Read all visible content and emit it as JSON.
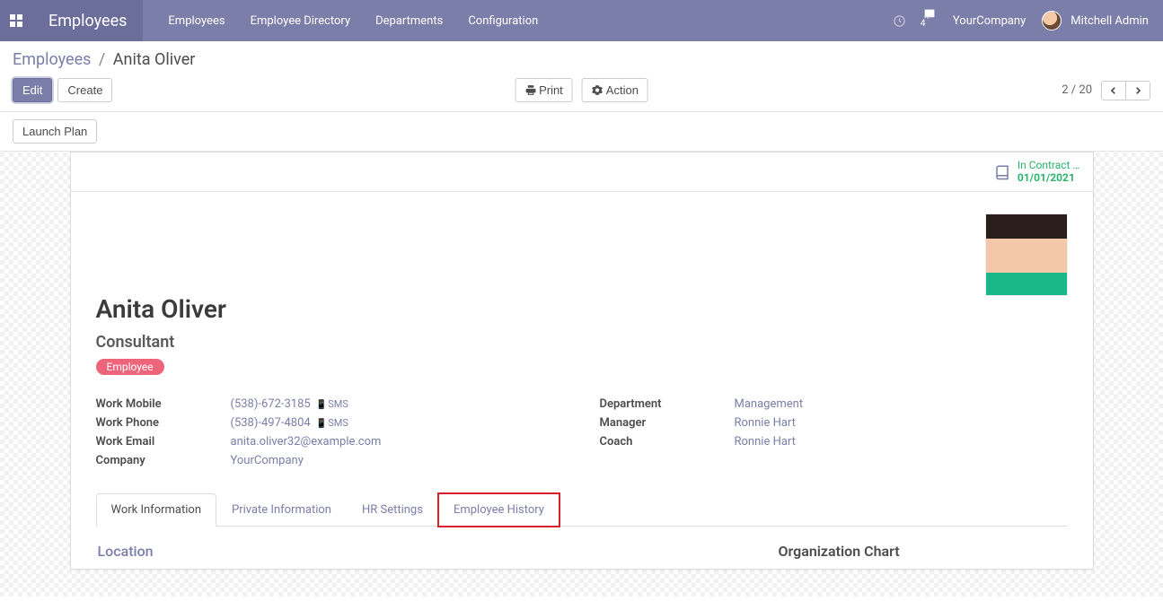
{
  "nav": {
    "app_name": "Employees",
    "links": [
      "Employees",
      "Employee Directory",
      "Departments",
      "Configuration"
    ],
    "message_count": "4",
    "company": "YourCompany",
    "user": "Mitchell Admin"
  },
  "breadcrumb": {
    "root": "Employees",
    "current": "Anita Oliver"
  },
  "toolbar": {
    "edit": "Edit",
    "create": "Create",
    "print": "Print",
    "action": "Action",
    "pager": "2 / 20"
  },
  "controls": {
    "launch_plan": "Launch Plan"
  },
  "status": {
    "label": "In Contract …",
    "date": "01/01/2021"
  },
  "employee": {
    "name": "Anita Oliver",
    "title": "Consultant",
    "tag": "Employee"
  },
  "left_fields": [
    {
      "label": "Work Mobile",
      "value": "(538)-672-3185",
      "sms": "SMS"
    },
    {
      "label": "Work Phone",
      "value": "(538)-497-4804",
      "sms": "SMS"
    },
    {
      "label": "Work Email",
      "value": "anita.oliver32@example.com"
    },
    {
      "label": "Company",
      "value": "YourCompany"
    }
  ],
  "right_fields": [
    {
      "label": "Department",
      "value": "Management"
    },
    {
      "label": "Manager",
      "value": "Ronnie Hart"
    },
    {
      "label": "Coach",
      "value": "Ronnie Hart"
    }
  ],
  "tabs": [
    "Work Information",
    "Private Information",
    "HR Settings",
    "Employee History"
  ],
  "tab_content": {
    "section1": "Location",
    "org_chart": "Organization Chart"
  }
}
